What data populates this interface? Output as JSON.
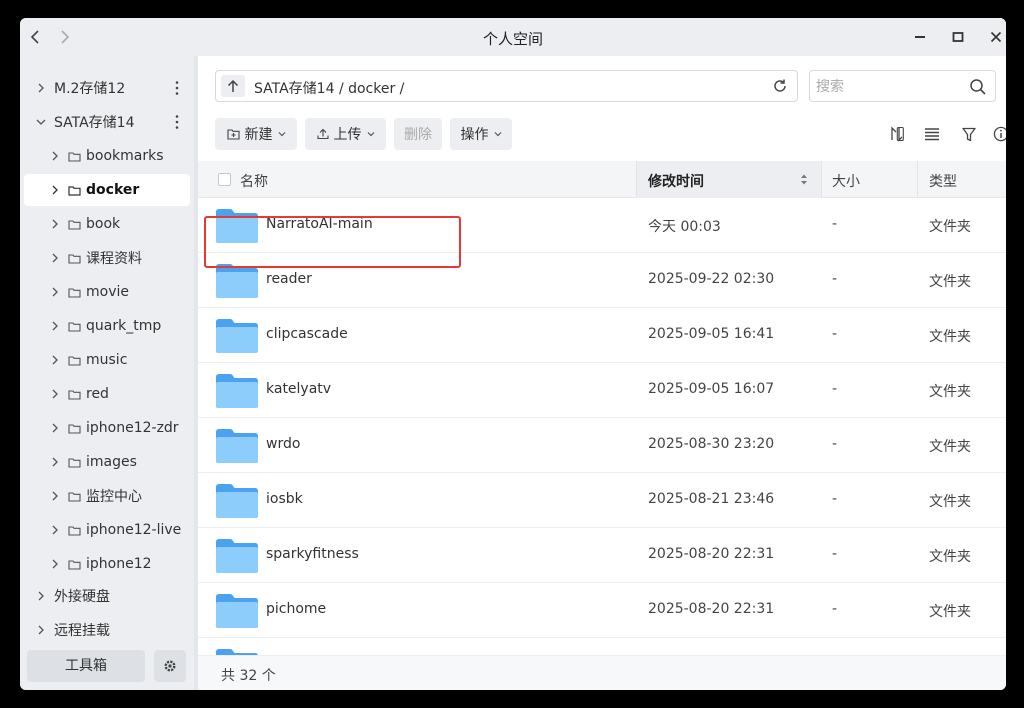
{
  "window": {
    "title": "个人空间"
  },
  "sidebar": {
    "items": [
      {
        "label": "M.2存储12",
        "level": 0,
        "expanded": false,
        "has_menu": true
      },
      {
        "label": "SATA存储14",
        "level": 0,
        "expanded": true,
        "has_menu": true
      },
      {
        "label": "bookmarks",
        "level": 1
      },
      {
        "label": "docker",
        "level": 1,
        "active": true
      },
      {
        "label": "book",
        "level": 1
      },
      {
        "label": "课程资料",
        "level": 1
      },
      {
        "label": "movie",
        "level": 1
      },
      {
        "label": "quark_tmp",
        "level": 1
      },
      {
        "label": "music",
        "level": 1
      },
      {
        "label": "red",
        "level": 1
      },
      {
        "label": "iphone12-zdr",
        "level": 1
      },
      {
        "label": "images",
        "level": 1
      },
      {
        "label": "监控中心",
        "level": 1
      },
      {
        "label": "iphone12-live",
        "level": 1
      },
      {
        "label": "iphone12",
        "level": 1
      },
      {
        "label": "外接硬盘",
        "level": 0
      },
      {
        "label": "远程挂载",
        "level": 0
      }
    ],
    "toolbox_label": "工具箱"
  },
  "pathbar": {
    "path": "SATA存储14 / docker /"
  },
  "search": {
    "placeholder": "搜索"
  },
  "toolbar": {
    "new_label": "新建",
    "upload_label": "上传",
    "delete_label": "删除",
    "actions_label": "操作"
  },
  "table": {
    "headers": {
      "name": "名称",
      "mtime": "修改时间",
      "size": "大小",
      "type": "类型"
    },
    "rows": [
      {
        "name": "NarratoAI-main",
        "mtime": "今天 00:03",
        "size": "-",
        "type": "文件夹",
        "highlighted": true
      },
      {
        "name": "reader",
        "mtime": "2025-09-22 02:30",
        "size": "-",
        "type": "文件夹"
      },
      {
        "name": "clipcascade",
        "mtime": "2025-09-05 16:41",
        "size": "-",
        "type": "文件夹"
      },
      {
        "name": "katelyatv",
        "mtime": "2025-09-05 16:07",
        "size": "-",
        "type": "文件夹"
      },
      {
        "name": "wrdo",
        "mtime": "2025-08-30 23:20",
        "size": "-",
        "type": "文件夹"
      },
      {
        "name": "iosbk",
        "mtime": "2025-08-21 23:46",
        "size": "-",
        "type": "文件夹"
      },
      {
        "name": "sparkyfitness",
        "mtime": "2025-08-20 22:31",
        "size": "-",
        "type": "文件夹"
      },
      {
        "name": "pichome",
        "mtime": "2025-08-20 22:31",
        "size": "-",
        "type": "文件夹"
      }
    ]
  },
  "footer": {
    "count_text": "共 32 个"
  },
  "colors": {
    "folder_light": "#8ccdfb",
    "folder_dark": "#4ba3f0",
    "highlight_border": "#e53935",
    "window_bg": "#f4f6f8"
  }
}
